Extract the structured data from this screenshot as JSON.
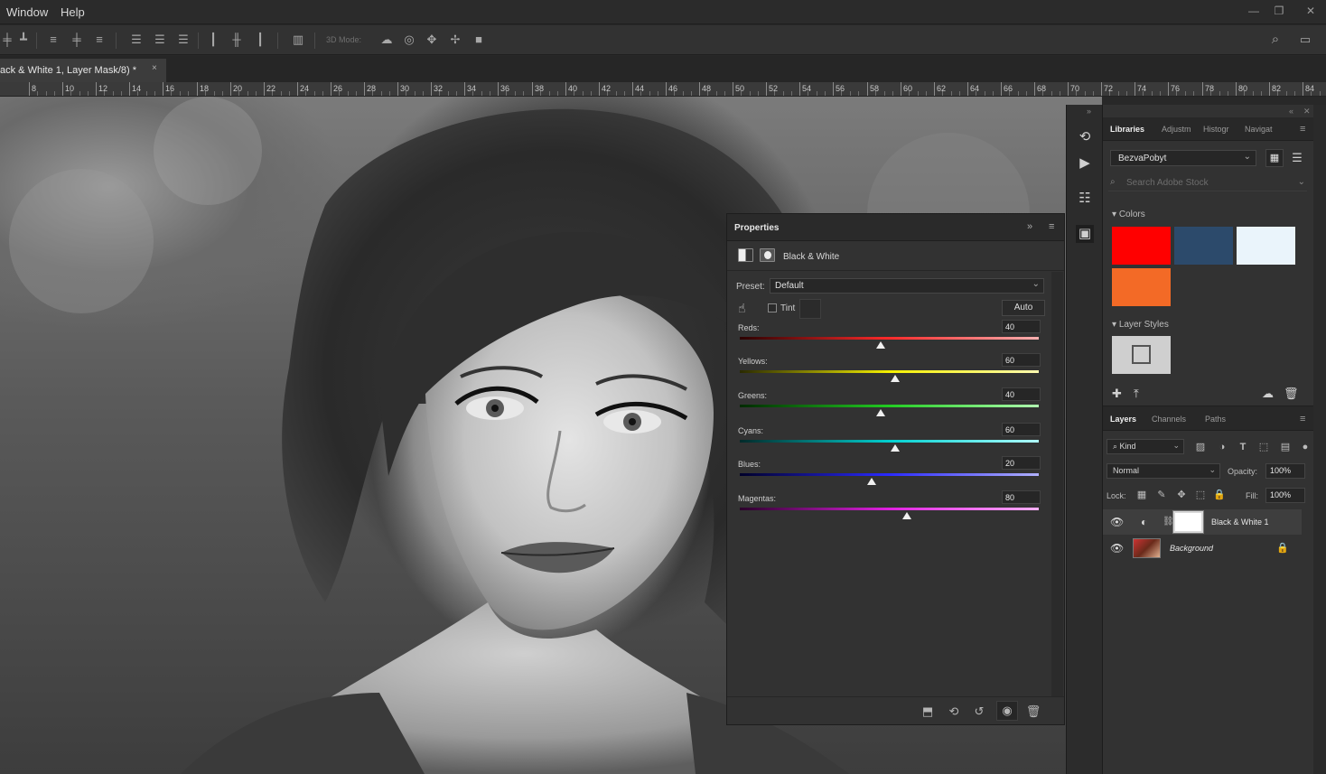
{
  "menubar": {
    "items": [
      "Window",
      "Help"
    ],
    "window_controls": [
      "minimize-icon",
      "restore-icon",
      "close-icon"
    ]
  },
  "optionsbar": {
    "mode_3d_label": "3D Mode:",
    "icons": [
      "align-top-edges-icon",
      "align-vertical-centers-icon",
      "align-bottom-edges-icon",
      "align-left-edges-icon",
      "align-horizontal-centers-icon",
      "align-right-edges-icon",
      "distribute-top-icon",
      "distribute-vcenter-icon",
      "distribute-bottom-icon",
      "distribute-left-icon",
      "distribute-hcenter-icon",
      "distribute-right-icon",
      "auto-align-icon",
      "orbit-3d-icon",
      "roll-3d-icon",
      "pan-3d-icon",
      "slide-3d-icon",
      "scale-3d-icon"
    ],
    "search_icon": "search-icon",
    "workspace_icon": "workspace-icon"
  },
  "document": {
    "tab_title": "ack & White 1, Layer Mask/8) *",
    "close_glyph": "×"
  },
  "ruler": {
    "labels": [
      "8",
      "10",
      "12",
      "14",
      "16",
      "18",
      "20",
      "22",
      "24",
      "26",
      "28",
      "30",
      "32",
      "34",
      "36",
      "38",
      "40",
      "42",
      "44",
      "46",
      "48",
      "50",
      "52",
      "54",
      "56",
      "58",
      "60",
      "62",
      "64",
      "66",
      "68",
      "70",
      "72",
      "74",
      "76",
      "78",
      "80",
      "82",
      "84"
    ]
  },
  "properties": {
    "title": "Properties",
    "adjustment_name": "Black & White",
    "preset_label": "Preset:",
    "preset_value": "Default",
    "tint_label": "Tint",
    "auto_label": "Auto",
    "sliders": [
      {
        "label": "Reds:",
        "value": "40",
        "position": 0.47,
        "gradient": [
          "#2a0000",
          "#ff2a2a",
          "#ffb0b0"
        ]
      },
      {
        "label": "Yellows:",
        "value": "60",
        "position": 0.52,
        "gradient": [
          "#2a2a00",
          "#f5f000",
          "#fffbb0"
        ]
      },
      {
        "label": "Greens:",
        "value": "40",
        "position": 0.47,
        "gradient": [
          "#002a00",
          "#22cc22",
          "#b0ffb0"
        ]
      },
      {
        "label": "Cyans:",
        "value": "60",
        "position": 0.52,
        "gradient": [
          "#002a2a",
          "#00d0d0",
          "#b0ffff"
        ]
      },
      {
        "label": "Blues:",
        "value": "20",
        "position": 0.44,
        "gradient": [
          "#00002a",
          "#2a2aff",
          "#b0b0ff"
        ]
      },
      {
        "label": "Magentas:",
        "value": "80",
        "position": 0.56,
        "gradient": [
          "#2a002a",
          "#e020e0",
          "#ffb0ff"
        ]
      }
    ],
    "footer_icons": [
      "clip-to-layer-icon",
      "view-previous-icon",
      "reset-icon",
      "visibility-icon",
      "trash-icon"
    ]
  },
  "dock": {
    "icons": [
      "history-icon",
      "actions-play-icon",
      "character-icon",
      "properties-dock-icon"
    ]
  },
  "libraries": {
    "tabs": [
      "Libraries",
      "Adjustm",
      "Histogr",
      "Navigat"
    ],
    "library_name": "BezvaPobyt",
    "search_placeholder": "Search Adobe Stock",
    "colors_heading": "Colors",
    "colors": [
      "#ff0000",
      "#2c4a6b",
      "#eaf4fb",
      "#f36a26"
    ],
    "layer_styles_heading": "Layer Styles"
  },
  "layers": {
    "tabs": [
      "Layers",
      "Channels",
      "Paths"
    ],
    "kind_label": "Kind",
    "blend_mode": "Normal",
    "opacity_label": "Opacity:",
    "opacity_value": "100%",
    "lock_label": "Lock:",
    "fill_label": "Fill:",
    "fill_value": "100%",
    "items": [
      {
        "name": "Black & White 1",
        "type": "adjustment",
        "visible": true
      },
      {
        "name": "Background",
        "type": "pixel",
        "visible": true,
        "locked": true
      }
    ]
  }
}
